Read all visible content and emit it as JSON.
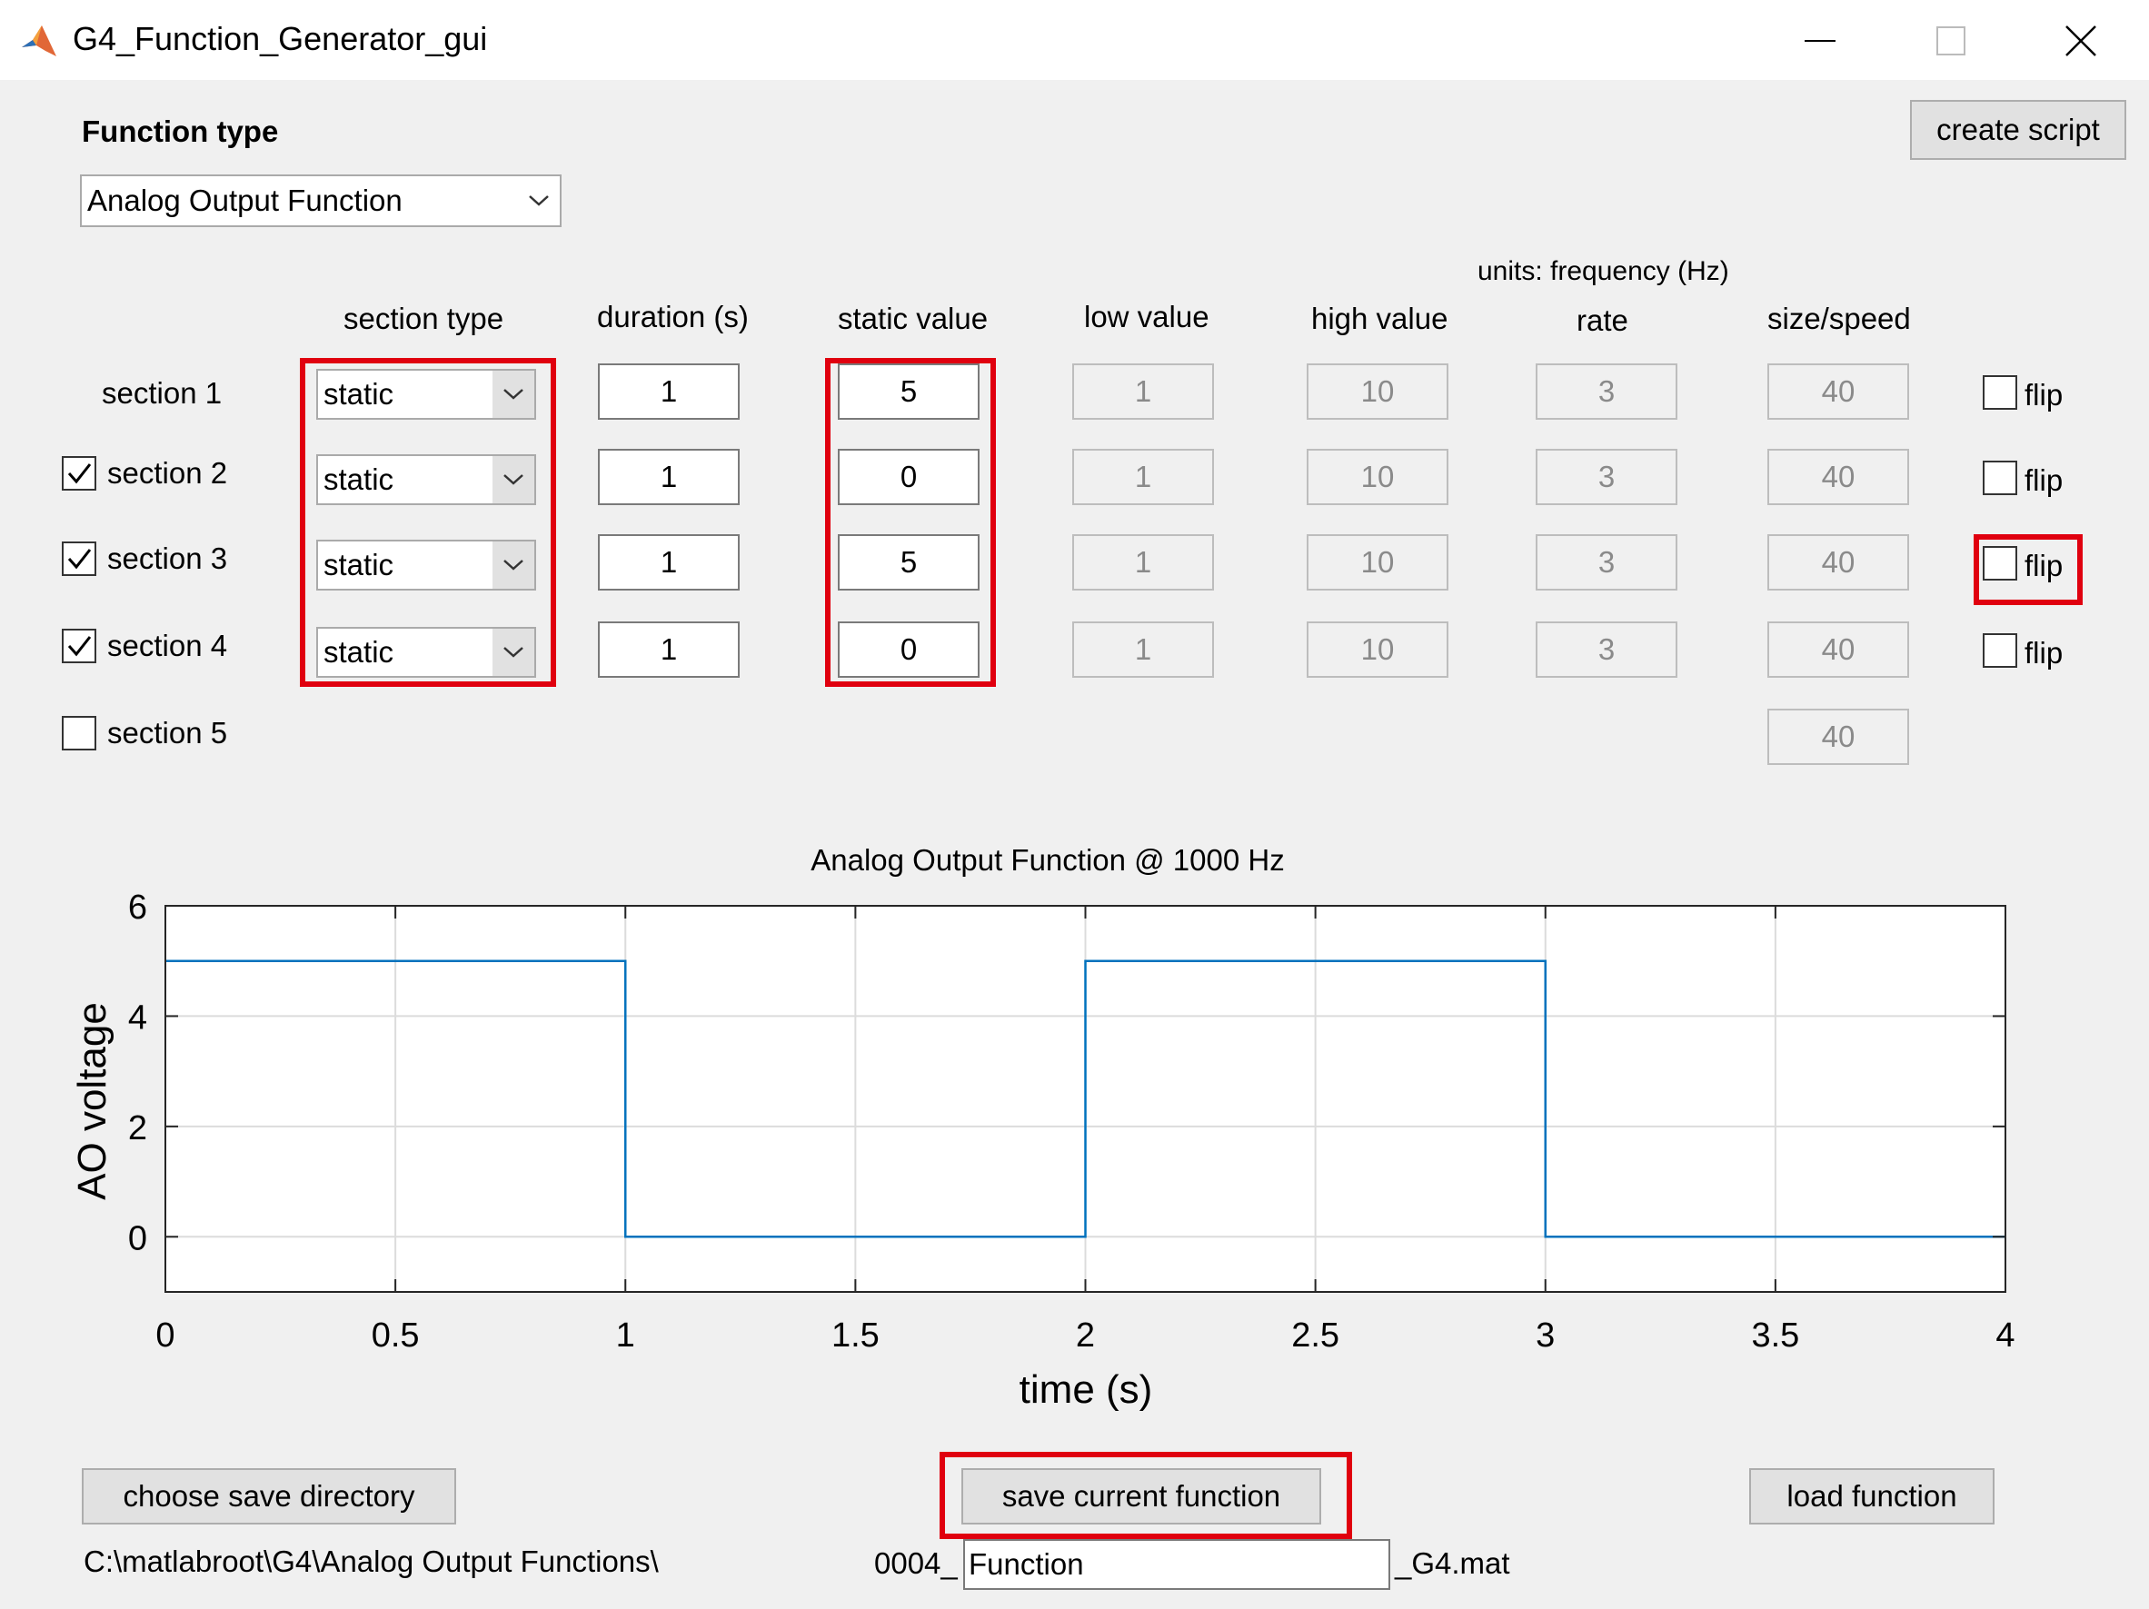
{
  "window": {
    "title": "G4_Function_Generator_gui"
  },
  "function_type": {
    "label": "Function type",
    "selected": "Analog Output Function"
  },
  "toolbar": {
    "create_script": "create script"
  },
  "columns": {
    "units_note": "units:  frequency (Hz)",
    "section_type": "section type",
    "duration": "duration (s)",
    "static_value": "static value",
    "low_value": "low value",
    "high_value": "high value",
    "rate": "rate",
    "size_speed": "size/speed"
  },
  "flip_label": "flip",
  "sections": [
    {
      "label": "section 1",
      "has_checkbox": false,
      "checked": false,
      "type": "static",
      "duration": "1",
      "static_value": "5",
      "low_value": "1",
      "high_value": "10",
      "rate": "3",
      "size_speed": "40",
      "flip": false
    },
    {
      "label": "section 2",
      "has_checkbox": true,
      "checked": true,
      "type": "static",
      "duration": "1",
      "static_value": "0",
      "low_value": "1",
      "high_value": "10",
      "rate": "3",
      "size_speed": "40",
      "flip": false
    },
    {
      "label": "section 3",
      "has_checkbox": true,
      "checked": true,
      "type": "static",
      "duration": "1",
      "static_value": "5",
      "low_value": "1",
      "high_value": "10",
      "rate": "3",
      "size_speed": "40",
      "flip": false
    },
    {
      "label": "section 4",
      "has_checkbox": true,
      "checked": true,
      "type": "static",
      "duration": "1",
      "static_value": "0",
      "low_value": "1",
      "high_value": "10",
      "rate": "3",
      "size_speed": "40",
      "flip": false
    },
    {
      "label": "section 5",
      "has_checkbox": true,
      "checked": false,
      "size_speed": "40"
    }
  ],
  "chart_data": {
    "type": "line",
    "title": "Analog Output Function @ 1000 Hz",
    "xlabel": "time (s)",
    "ylabel": "AO voltage",
    "xlim": [
      0,
      4
    ],
    "ylim": [
      -1,
      6
    ],
    "xticks": [
      "0",
      "0.5",
      "1",
      "1.5",
      "2",
      "2.5",
      "3",
      "3.5",
      "4"
    ],
    "yticks": [
      "0",
      "2",
      "4",
      "6"
    ],
    "grid": true,
    "line_color": "#0072bd",
    "series": [
      {
        "x": [
          0,
          1,
          1,
          2,
          2,
          3,
          3,
          4
        ],
        "y": [
          5,
          5,
          0,
          0,
          5,
          5,
          0,
          0
        ]
      }
    ]
  },
  "footer": {
    "choose_dir": "choose save directory",
    "save_current": "save current function",
    "load": "load function",
    "path": "C:\\matlabroot\\G4\\Analog Output Functions\\",
    "file_prefix": "0004_",
    "file_name": "Function",
    "file_suffix": "_G4.mat"
  },
  "highlight_color": "#e0000f"
}
